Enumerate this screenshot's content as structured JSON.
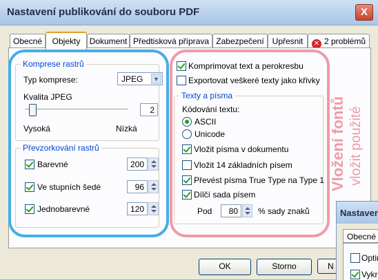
{
  "window": {
    "title": "Nastavení publikování do souboru PDF",
    "close_glyph": "X"
  },
  "tabs": [
    {
      "label": "Obecné",
      "active": false
    },
    {
      "label": "Objekty",
      "active": true
    },
    {
      "label": "Dokument",
      "active": false
    },
    {
      "label": "Předtisková příprava",
      "active": false
    },
    {
      "label": "Zabezpečení",
      "active": false
    },
    {
      "label": "Upřesnit",
      "active": false
    },
    {
      "label": "2 problémů",
      "active": false
    }
  ],
  "compression": {
    "group_title": "Komprese rastrů",
    "type_label": "Typ komprese:",
    "type_value": "JPEG",
    "quality_label": "Kvalita JPEG",
    "quality_value": "2",
    "quality_level": 0.0,
    "low_label": "Vysoká",
    "high_label": "Nízká"
  },
  "resampling": {
    "group_title": "Převzorkování rastrů",
    "items": [
      {
        "label": "Barevné",
        "checked": true,
        "value": "200"
      },
      {
        "label": "Ve stupních šedé",
        "checked": true,
        "value": "96"
      },
      {
        "label": "Jednobarevné",
        "checked": true,
        "value": "120"
      }
    ]
  },
  "options": {
    "compress_text": {
      "label": "Komprimovat text a perokresbu",
      "checked": true
    },
    "export_text_as_curves": {
      "label": "Exportovat veškeré texty jako křivky",
      "checked": false
    }
  },
  "fonts": {
    "group_title": "Texty a písma",
    "encoding_label": "Kódování textu:",
    "encodings": [
      {
        "label": "ASCII",
        "selected": true
      },
      {
        "label": "Unicode",
        "selected": false
      }
    ],
    "checks": [
      {
        "label": "Vložit písma v dokumentu",
        "checked": true
      },
      {
        "label": "Vložit 14 základních písem",
        "checked": false
      },
      {
        "label": "Převést písma True Type na Type 1",
        "checked": true
      },
      {
        "label": "Dílčí sada písem",
        "checked": true
      }
    ],
    "subset_label": "Pod",
    "subset_value": "80",
    "subset_suffix": "% sady znaků"
  },
  "annotations": {
    "line1": "Vložení fontů",
    "line2": "vložit použité"
  },
  "buttons": {
    "ok": "OK",
    "cancel": "Storno",
    "help_partial": "N"
  },
  "second_window": {
    "title": "Nastaven",
    "tab": "Obecné",
    "item1": "Optin",
    "item2": "Vykre"
  },
  "colors": {
    "blue_annotation": "#45aee4",
    "red_annotation": "#ef9ba6",
    "error_badge": "#d6262b"
  }
}
